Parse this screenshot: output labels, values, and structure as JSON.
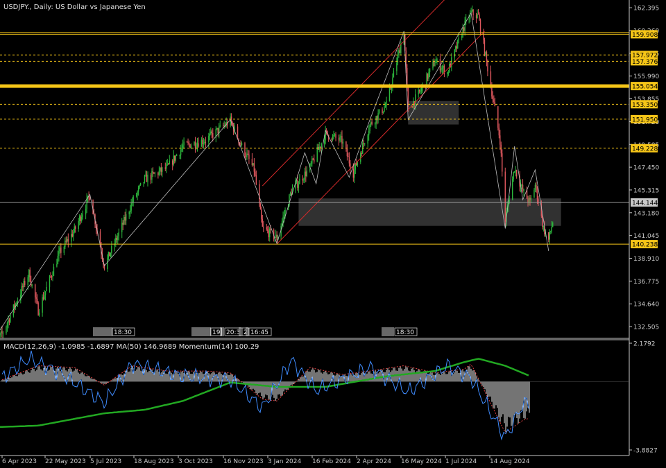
{
  "header": {
    "symbol_title": "USDJPY., Daily:  US Dollar vs Japanese Yen",
    "indicator_title": "MACD(12,26,9) -1.0985 -1.6897 MA(50) 146.9689 Momentum(14) 100.29"
  },
  "colors": {
    "background": "#000000",
    "grid": "#3a3a3a",
    "axis_text": "#c8c8c8",
    "bull": "#2db83d",
    "bear": "#e0585e",
    "level_line": "#f5c518",
    "channel": "#d42a2a",
    "zigzag": "#bdbdbd",
    "zone": "#3a3a3a",
    "macd_hist": "#e8e8e8",
    "macd_signal": "#e04040",
    "ma50": "#22a822",
    "momentum": "#3f8cff"
  },
  "session_markers": [
    {
      "label": "18:30"
    },
    {
      "label": "19"
    },
    {
      "label": "20:3"
    },
    {
      "label": "2"
    },
    {
      "label": "16:45"
    },
    {
      "label": "18:30"
    }
  ],
  "chart_data": [
    {
      "type": "candlestick",
      "title": "USDJPY., Daily:  US Dollar vs Japanese Yen",
      "ylim": [
        131.6,
        162.6
      ],
      "y_ticks": [
        "162.395",
        "160.260",
        "158.125",
        "155.990",
        "153.855",
        "151.720",
        "149.585",
        "147.450",
        "145.315",
        "143.180",
        "141.045",
        "138.910",
        "136.775",
        "134.640",
        "132.505"
      ],
      "x_ticks": [
        "6 Apr 2023",
        "22 May 2023",
        "5 Jul 2023",
        "18 Aug 2023",
        "3 Oct 2023",
        "16 Nov 2023",
        "3 Jan 2024",
        "16 Feb 2024",
        "2 Apr 2024",
        "16 May 2024",
        "1 Jul 2024",
        "14 Aug 2024"
      ],
      "x_range": [
        "2023-04-06",
        "2024-08-29"
      ],
      "key_points": [
        {
          "date": "2023-03-24",
          "close": 130.6
        },
        {
          "date": "2023-04-06",
          "close": 131.8
        },
        {
          "date": "2023-05-02",
          "close": 137.5
        },
        {
          "date": "2023-05-11",
          "close": 134.0
        },
        {
          "date": "2023-06-01",
          "close": 139.5
        },
        {
          "date": "2023-06-15",
          "close": 141.5
        },
        {
          "date": "2023-06-30",
          "close": 144.8
        },
        {
          "date": "2023-07-14",
          "close": 138.2
        },
        {
          "date": "2023-07-28",
          "close": 141.2
        },
        {
          "date": "2023-08-10",
          "close": 144.2
        },
        {
          "date": "2023-08-22",
          "close": 146.3
        },
        {
          "date": "2023-09-13",
          "close": 147.4
        },
        {
          "date": "2023-09-28",
          "close": 149.4
        },
        {
          "date": "2023-10-20",
          "close": 150.0
        },
        {
          "date": "2023-11-13",
          "close": 151.8
        },
        {
          "date": "2023-11-24",
          "close": 149.4
        },
        {
          "date": "2023-12-06",
          "close": 147.2
        },
        {
          "date": "2023-12-14",
          "close": 141.7
        },
        {
          "date": "2023-12-28",
          "close": 140.8
        },
        {
          "date": "2024-01-11",
          "close": 145.2
        },
        {
          "date": "2024-01-29",
          "close": 147.4
        },
        {
          "date": "2024-02-13",
          "close": 150.6
        },
        {
          "date": "2024-02-29",
          "close": 149.9
        },
        {
          "date": "2024-03-11",
          "close": 146.9
        },
        {
          "date": "2024-03-27",
          "close": 151.4
        },
        {
          "date": "2024-04-12",
          "close": 153.3
        },
        {
          "date": "2024-04-29",
          "close": 160.2
        },
        {
          "date": "2024-05-03",
          "close": 152.8
        },
        {
          "date": "2024-05-15",
          "close": 154.6
        },
        {
          "date": "2024-05-29",
          "close": 157.4
        },
        {
          "date": "2024-06-10",
          "close": 156.3
        },
        {
          "date": "2024-06-26",
          "close": 160.6
        },
        {
          "date": "2024-07-03",
          "close": 161.9
        },
        {
          "date": "2024-07-10",
          "close": 161.6
        },
        {
          "date": "2024-07-18",
          "close": 157.3
        },
        {
          "date": "2024-07-31",
          "close": 150.0
        },
        {
          "date": "2024-08-05",
          "close": 142.5
        },
        {
          "date": "2024-08-14",
          "close": 147.4
        },
        {
          "date": "2024-08-22",
          "close": 145.2
        },
        {
          "date": "2024-08-29",
          "close": 144.1
        },
        {
          "date": "2024-09-03",
          "close": 145.8
        },
        {
          "date": "2024-09-11",
          "close": 141.7
        },
        {
          "date": "2024-09-16",
          "close": 140.6
        },
        {
          "date": "2024-09-24",
          "close": 144.1
        }
      ],
      "last_price": "144.144",
      "levels": [
        {
          "label": "159.908",
          "value": 159.908,
          "style": "solid"
        },
        {
          "label": "157.972",
          "value": 157.972,
          "style": "dashed"
        },
        {
          "label": "157.376",
          "value": 157.376,
          "style": "dashed"
        },
        {
          "label": "155.054",
          "value": 155.054,
          "style": "thick"
        },
        {
          "label": "153.350",
          "value": 153.35,
          "style": "dashed"
        },
        {
          "label": "151.950",
          "value": 151.95,
          "style": "dashed"
        },
        {
          "label": "149.228",
          "value": 149.228,
          "style": "dashed"
        },
        {
          "label": "140.238",
          "value": 140.238,
          "style": "solid"
        }
      ],
      "channel": {
        "lower": [
          {
            "date": "2023-12-28",
            "value": 140.25
          },
          {
            "date": "2024-07-16",
            "value": 160.2
          }
        ],
        "upper": [
          {
            "date": "2023-12-14",
            "value": 145.7
          },
          {
            "date": "2024-07-01",
            "value": 165.5
          }
        ]
      },
      "zigzag": [
        {
          "date": "2023-03-24",
          "value": 130.6
        },
        {
          "date": "2023-06-30",
          "value": 144.9
        },
        {
          "date": "2023-07-14",
          "value": 138.2
        },
        {
          "date": "2023-11-13",
          "value": 151.9
        },
        {
          "date": "2023-12-28",
          "value": 140.3
        },
        {
          "date": "2024-01-24",
          "value": 148.8
        },
        {
          "date": "2024-02-04",
          "value": 145.9
        },
        {
          "date": "2024-02-13",
          "value": 150.9
        },
        {
          "date": "2024-03-07",
          "value": 146.5
        },
        {
          "date": "2024-03-27",
          "value": 151.9
        },
        {
          "date": "2024-04-29",
          "value": 160.2
        },
        {
          "date": "2024-05-03",
          "value": 151.9
        },
        {
          "date": "2024-07-03",
          "value": 161.9
        },
        {
          "date": "2024-08-05",
          "value": 141.7
        },
        {
          "date": "2024-08-14",
          "value": 149.4
        },
        {
          "date": "2024-08-22",
          "value": 144.4
        },
        {
          "date": "2024-09-03",
          "value": 147.2
        },
        {
          "date": "2024-09-16",
          "value": 139.6
        }
      ],
      "zones": [
        {
          "from": "2024-05-03",
          "to": "2024-06-21",
          "high": 153.65,
          "low": 151.45
        },
        {
          "from": "2024-01-18",
          "to": "2024-09-28",
          "high": 144.52,
          "low": 141.95
        }
      ]
    },
    {
      "type": "line",
      "title": "MACD(12,26,9) -1.0985 -1.6897 MA(50) 146.9689 Momentum(14) 100.29",
      "ylim": [
        -3.8827,
        2.1792
      ],
      "y_ticks": [
        "2.1792",
        "-3.8827"
      ],
      "series": [
        {
          "name": "MACD(12,26,9)",
          "points": [
            [
              "2023-04-06",
              0.1
            ],
            [
              "2023-05-11",
              0.9
            ],
            [
              "2023-06-15",
              0.8
            ],
            [
              "2023-07-14",
              -0.2
            ],
            [
              "2023-08-10",
              0.9
            ],
            [
              "2023-09-13",
              0.6
            ],
            [
              "2023-10-20",
              0.6
            ],
            [
              "2023-11-13",
              0.5
            ],
            [
              "2023-12-14",
              -1.0
            ],
            [
              "2023-12-28",
              -1.1
            ],
            [
              "2024-01-29",
              0.8
            ],
            [
              "2024-02-29",
              0.4
            ],
            [
              "2024-03-27",
              0.6
            ],
            [
              "2024-04-29",
              0.9
            ],
            [
              "2024-05-29",
              0.5
            ],
            [
              "2024-06-26",
              0.7
            ],
            [
              "2024-07-03",
              1.0
            ],
            [
              "2024-08-05",
              -2.9
            ],
            [
              "2024-08-22",
              -2.2
            ],
            [
              "2024-09-16",
              -1.7
            ],
            [
              "2024-09-24",
              -1.1
            ]
          ]
        },
        {
          "name": "MA(50)",
          "points": [
            [
              "2023-03-24",
              -2.6
            ],
            [
              "2023-05-11",
              -2.5
            ],
            [
              "2023-07-14",
              -1.8
            ],
            [
              "2023-08-22",
              -1.6
            ],
            [
              "2023-09-28",
              -1.1
            ],
            [
              "2023-11-13",
              -0.05
            ],
            [
              "2023-12-28",
              -0.3
            ],
            [
              "2024-02-13",
              -0.3
            ],
            [
              "2024-04-12",
              0.3
            ],
            [
              "2024-05-29",
              0.6
            ],
            [
              "2024-06-26",
              1.1
            ],
            [
              "2024-07-10",
              1.3
            ],
            [
              "2024-08-05",
              0.9
            ],
            [
              "2024-09-11",
              0.0
            ]
          ]
        },
        {
          "name": "Momentum(14)",
          "points": [
            [
              "2023-04-06",
              0.2
            ],
            [
              "2023-05-02",
              1.3
            ],
            [
              "2023-06-01",
              0.5
            ],
            [
              "2023-07-14",
              -1.2
            ],
            [
              "2023-08-10",
              1.0
            ],
            [
              "2023-09-28",
              0.3
            ],
            [
              "2023-11-13",
              0.1
            ],
            [
              "2023-12-14",
              -1.5
            ],
            [
              "2024-01-11",
              1.2
            ],
            [
              "2024-02-04",
              -0.5
            ],
            [
              "2024-03-27",
              0.8
            ],
            [
              "2024-05-03",
              -0.6
            ],
            [
              "2024-06-10",
              0.9
            ],
            [
              "2024-07-03",
              0.2
            ],
            [
              "2024-08-05",
              -3.2
            ],
            [
              "2024-08-22",
              -1.3
            ],
            [
              "2024-09-16",
              -1.0
            ],
            [
              "2024-09-24",
              -0.2
            ]
          ]
        }
      ]
    }
  ]
}
